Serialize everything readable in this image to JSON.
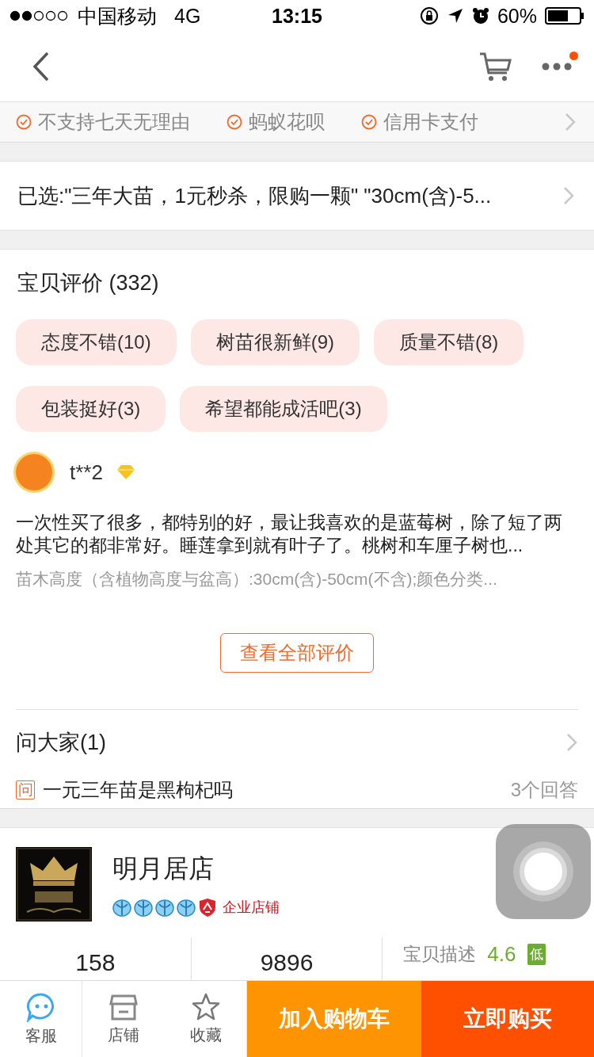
{
  "status_bar": {
    "carrier": "中国移动",
    "network": "4G",
    "time": "13:15",
    "battery": "60%"
  },
  "nav": {
    "more_notification": true
  },
  "guarantees": [
    "不支持七天无理由",
    "蚂蚁花呗",
    "信用卡支付"
  ],
  "selected_spec": "已选:\"三年大苗，1元秒杀，限购一颗\" \"30cm(含)-5...",
  "reviews": {
    "title": "宝贝评价",
    "count": "(332)",
    "tags": [
      "态度不错(10)",
      "树苗很新鲜(9)",
      "质量不错(8)",
      "包装挺好(3)",
      "希望都能成活吧(3)"
    ],
    "review": {
      "user": "t**2",
      "text": "一次性买了很多，都特别的好，最让我喜欢的是蓝莓树，除了短了两处其它的都非常好。睡莲拿到就有叶子了。桃树和车厘子树也...",
      "spec": "苗木高度（含植物高度与盆高）:30cm(含)-50cm(不含);颜色分类..."
    },
    "view_all": "查看全部评价"
  },
  "questions": {
    "title": "问大家(1)",
    "badge": "问",
    "question": "一元三年苗是黑枸杞吗",
    "answers": "3个回答"
  },
  "shop": {
    "name": "明月居店",
    "stars": 4,
    "type": "企业店铺",
    "stats": [
      "158",
      "9896"
    ],
    "ratings": [
      {
        "label": "宝贝描述",
        "score": "4.6",
        "badge": "低"
      }
    ]
  },
  "tabbar": {
    "items": [
      {
        "kind": "service",
        "label": "客服"
      },
      {
        "kind": "shop",
        "label": "店铺"
      },
      {
        "kind": "favorite",
        "label": "收藏"
      }
    ],
    "add_cart": "加入购物车",
    "buy": "立即购买"
  }
}
